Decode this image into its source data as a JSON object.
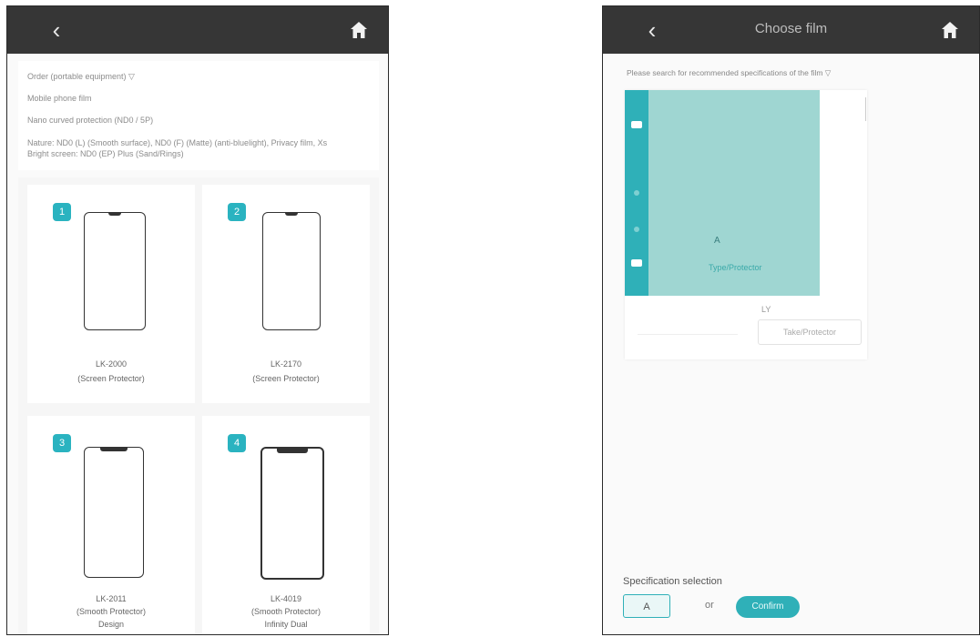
{
  "left": {
    "info_lines": [
      "Order (portable equipment) ▽",
      "Mobile phone film",
      "Nano curved protection (ND0 / 5P)",
      "Nature: ND0 (L) (Smooth surface), ND0 (F) (Matte) (anti-bluelight), Privacy film, Xs",
      "Bright screen: ND0 (EP) Plus (Sand/Rings)"
    ],
    "cards": [
      {
        "badge": "1",
        "line1": "LK-2000",
        "line2": "(Screen Protector)"
      },
      {
        "badge": "2",
        "line1": "LK-2170",
        "line2": "(Screen Protector)"
      },
      {
        "badge": "3",
        "line1": "LK-2011",
        "line2": "(Smooth Protector)",
        "line3": "Design"
      },
      {
        "badge": "4",
        "line1": "LK-4019",
        "line2": "(Smooth Protector)",
        "line3": "Infinity Dual"
      }
    ]
  },
  "right": {
    "title": "Choose film",
    "hint": "Please search for recommended specifications of the film ▽",
    "preview": {
      "marker": "A",
      "tag": "Type/Protector",
      "below": "LY",
      "gray_button": "Take/Protector"
    },
    "spec": {
      "label": "Specification selection",
      "box_value": "A",
      "mid": "or",
      "pill": "Confirm"
    }
  },
  "colors": {
    "accent": "#2fb0b8",
    "topbar": "#363636",
    "teal_light": "#9fd6d2"
  },
  "icons": {
    "back": "chevron-left-icon",
    "home": "home-icon"
  }
}
